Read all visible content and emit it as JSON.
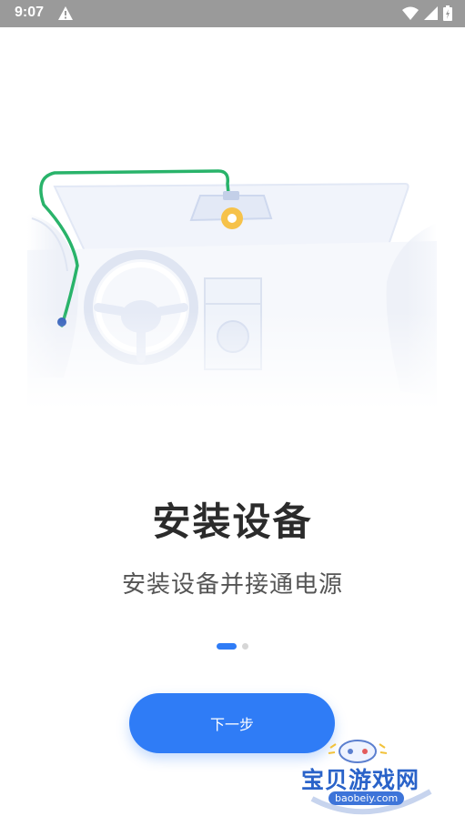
{
  "status_bar": {
    "time": "9:07",
    "icons": [
      "alert-icon",
      "wifi-icon",
      "signal-icon",
      "battery-icon"
    ]
  },
  "illustration": {
    "description_icon": "car-dashcam-illustration"
  },
  "onboarding": {
    "title": "安装设备",
    "subtitle": "安装设备并接通电源",
    "page_index": 1,
    "page_count": 2
  },
  "actions": {
    "next_label": "下一步"
  },
  "watermark": {
    "text": "宝贝游戏网",
    "url": "baobeiy.com"
  },
  "colors": {
    "accent": "#2f7cf6",
    "cable": "#29b36a",
    "camera_led": "#f6c24a"
  }
}
